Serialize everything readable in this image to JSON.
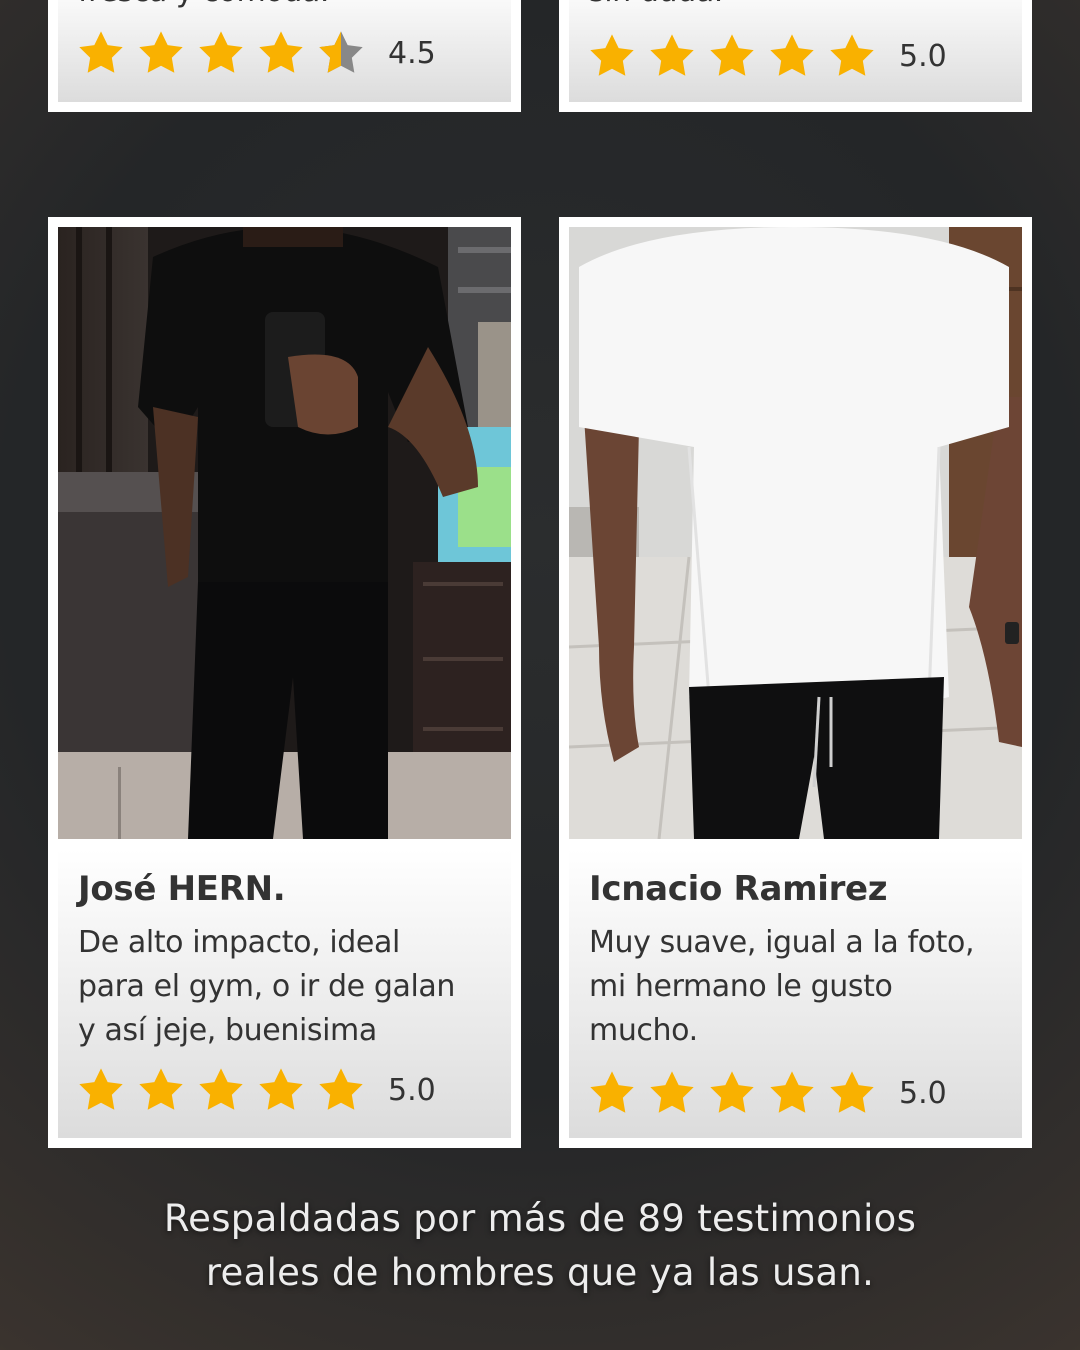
{
  "colors": {
    "star": "#f9b100",
    "star_empty": "#888888",
    "card_border": "#ffffff",
    "text": "#333333",
    "caption": "#ededed"
  },
  "reviews": [
    {
      "text_partial": "fresca y cómoda.",
      "rating": 4.5,
      "rating_label": "4.5"
    },
    {
      "text_partial": "sin duda.",
      "rating": 5.0,
      "rating_label": "5.0"
    },
    {
      "name": "José HERN.",
      "text_lines": [
        "De alto impacto, ideal",
        "para el gym, o ir de galan",
        "y así jeje, buenisima"
      ],
      "rating": 5.0,
      "rating_label": "5.0",
      "photo": "man-black-shirt-mirror-selfie"
    },
    {
      "name": "Icnacio Ramirez",
      "text_lines": [
        "Muy suave, igual a la foto,",
        "mi hermano le gusto",
        "mucho."
      ],
      "rating": 5.0,
      "rating_label": "5.0",
      "photo": "man-white-shirt"
    }
  ],
  "caption": {
    "line1": "Respaldadas por más de 89 testimonios",
    "line2": "reales de hombres que ya las usan."
  }
}
